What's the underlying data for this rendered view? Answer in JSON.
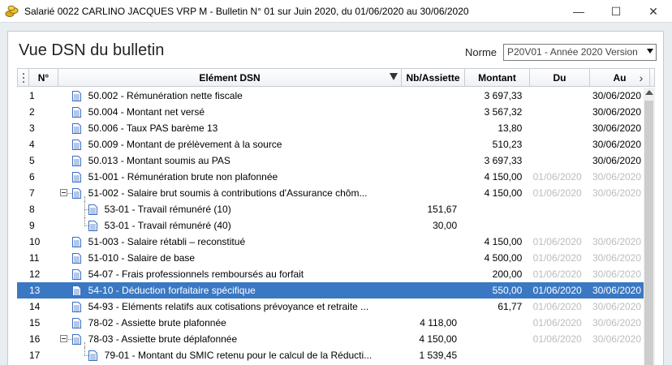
{
  "window": {
    "title": "Salarié 0022 CARLINO JACQUES VRP M - Bulletin N° 01 sur Juin 2020, du 01/06/2020 au 30/06/2020",
    "minimize": "—",
    "maximize": "☐",
    "close": "✕"
  },
  "page": {
    "title": "Vue DSN du bulletin"
  },
  "norme": {
    "label": "Norme",
    "selected": "P20V01 - Année 2020 Version"
  },
  "columns": {
    "no": "N°",
    "element": "Elément DSN",
    "nb_assiette": "Nb/Assiette",
    "montant": "Montant",
    "du": "Du",
    "au": "Au",
    "more": "›"
  },
  "rows": [
    {
      "no": "1",
      "element": "50.002 - Rémunération nette fiscale",
      "nb": "",
      "montant": "3 697,33",
      "du": "",
      "au": "30/06/2020",
      "dim_dates": false
    },
    {
      "no": "2",
      "element": "50.004 - Montant net versé",
      "nb": "",
      "montant": "3 567,32",
      "du": "",
      "au": "30/06/2020",
      "dim_dates": false
    },
    {
      "no": "3",
      "element": "50.006 - Taux PAS barème 13",
      "nb": "",
      "montant": "13,80",
      "du": "",
      "au": "30/06/2020",
      "dim_dates": false
    },
    {
      "no": "4",
      "element": "50.009 - Montant de prélèvement à la source",
      "nb": "",
      "montant": "510,23",
      "du": "",
      "au": "30/06/2020",
      "dim_dates": false
    },
    {
      "no": "5",
      "element": "50.013 - Montant soumis au PAS",
      "nb": "",
      "montant": "3 697,33",
      "du": "",
      "au": "30/06/2020",
      "dim_dates": false
    },
    {
      "no": "6",
      "element": "51-001 - Rémunération brute non plafonnée",
      "nb": "",
      "montant": "4 150,00",
      "du": "01/06/2020",
      "au": "30/06/2020",
      "dim_dates": true
    },
    {
      "no": "7",
      "element": "51-002 - Salaire brut soumis à contributions d'Assurance chôm...",
      "nb": "",
      "montant": "4 150,00",
      "du": "01/06/2020",
      "au": "30/06/2020",
      "dim_dates": true
    },
    {
      "no": "8",
      "element": "53-01 - Travail rémunéré (10)",
      "nb": "151,67",
      "montant": "",
      "du": "",
      "au": "",
      "dim_dates": false
    },
    {
      "no": "9",
      "element": "53-01 - Travail rémunéré (40)",
      "nb": "30,00",
      "montant": "",
      "du": "",
      "au": "",
      "dim_dates": false
    },
    {
      "no": "10",
      "element": "51-003 - Salaire rétabli – reconstitué",
      "nb": "",
      "montant": "4 150,00",
      "du": "01/06/2020",
      "au": "30/06/2020",
      "dim_dates": true
    },
    {
      "no": "11",
      "element": "51-010 - Salaire de base",
      "nb": "",
      "montant": "4 500,00",
      "du": "01/06/2020",
      "au": "30/06/2020",
      "dim_dates": true
    },
    {
      "no": "12",
      "element": "54-07 - Frais professionnels remboursés au forfait",
      "nb": "",
      "montant": "200,00",
      "du": "01/06/2020",
      "au": "30/06/2020",
      "dim_dates": true
    },
    {
      "no": "13",
      "element": "54-10 - Déduction forfaitaire spécifique",
      "nb": "",
      "montant": "550,00",
      "du": "01/06/2020",
      "au": "30/06/2020",
      "dim_dates": false
    },
    {
      "no": "14",
      "element": "54-93 - Eléments relatifs aux cotisations prévoyance et retraite ...",
      "nb": "",
      "montant": "61,77",
      "du": "01/06/2020",
      "au": "30/06/2020",
      "dim_dates": true
    },
    {
      "no": "15",
      "element": "78-02 - Assiette  brute plafonnée",
      "nb": "4 118,00",
      "montant": "",
      "du": "01/06/2020",
      "au": "30/06/2020",
      "dim_dates": true
    },
    {
      "no": "16",
      "element": "78-03 - Assiette brute déplafonnée",
      "nb": "4 150,00",
      "montant": "",
      "du": "01/06/2020",
      "au": "30/06/2020",
      "dim_dates": true
    },
    {
      "no": "17",
      "element": "79-01 - Montant du SMIC retenu pour le calcul de la Réducti...",
      "nb": "1 539,45",
      "montant": "",
      "du": "",
      "au": "",
      "dim_dates": false
    }
  ],
  "colors": {
    "selected_row": "#3a78c3",
    "dim_text": "#bcbcbc",
    "doc_icon": "#3a6fc4"
  },
  "icons": {
    "app": "coins-icon",
    "row": "document-icon"
  }
}
